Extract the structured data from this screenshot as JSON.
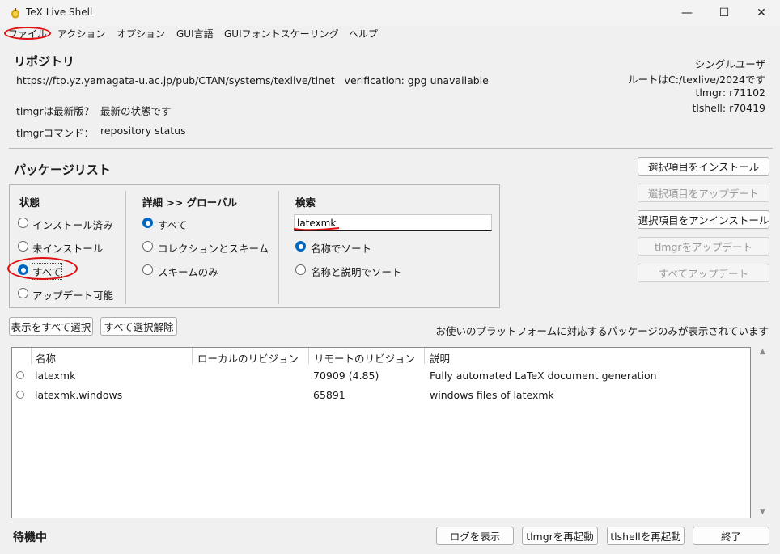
{
  "window": {
    "title": "TeX Live Shell",
    "minimize_glyph": "—",
    "maximize_glyph": "☐",
    "close_glyph": "✕"
  },
  "menu": [
    "ファイル",
    "アクション",
    "オプション",
    "GUI言語",
    "GUIフォントスケーリング",
    "ヘルプ"
  ],
  "repository": {
    "heading": "リポジトリ",
    "url_line": "https://ftp.yz.yamagata-u.ac.jp/pub/CTAN/systems/texlive/tlnet   verification: gpg unavailable",
    "tlmgr_latest_label": "tlmgrは最新版？",
    "tlmgr_latest_value": "最新の状態です",
    "tlmgr_command_label": "tlmgrコマンド：",
    "tlmgr_command_value": "repository status"
  },
  "info": {
    "user_mode": "シングルユーザ",
    "root": "ルートはC:/texlive/2024です",
    "tlmgr_rev": "tlmgr: r71102",
    "tlshell_rev": "tlshell: r70419"
  },
  "package_list": {
    "heading": "パッケージリスト"
  },
  "status_group": {
    "heading": "状態",
    "options": [
      "インストール済み",
      "未インストール",
      "すべて",
      "アップデート可能"
    ],
    "selected": 2
  },
  "detail_group": {
    "heading": "詳細 >> グローバル",
    "options": [
      "すべて",
      "コレクションとスキーム",
      "スキームのみ"
    ],
    "selected": 0
  },
  "search_group": {
    "heading": "検索",
    "value": "latexmk",
    "options": [
      "名称でソート",
      "名称と説明でソート"
    ],
    "selected": 0
  },
  "action_buttons": {
    "install": "選択項目をインストール",
    "update": "選択項目をアップデート",
    "uninstall": "選択項目をアンインストール",
    "update_tlmgr": "tlmgrをアップデート",
    "update_all": "すべてアップデート"
  },
  "selection": {
    "select_all": "表示をすべて選択",
    "deselect_all": "すべて選択解除",
    "platform_note": "お使いのプラットフォームに対応するパッケージのみが表示されています"
  },
  "table": {
    "columns": [
      "名称",
      "ローカルのリビジョン",
      "リモートのリビジョン",
      "説明"
    ],
    "rows": [
      [
        "latexmk",
        "",
        "70909 (4.85)",
        "Fully automated LaTeX document generation"
      ],
      [
        "latexmk.windows",
        "",
        "65891",
        "windows files of latexmk"
      ]
    ],
    "scroll_up": "▲",
    "scroll_down": "▼"
  },
  "footer": {
    "status": "待機中",
    "show_log": "ログを表示",
    "restart_tlmgr": "tlmgrを再起動",
    "restart_tlshell": "tlshellを再起動",
    "quit": "終了"
  },
  "colors": {
    "accent": "#0067c0",
    "annotation": "#e01010"
  }
}
